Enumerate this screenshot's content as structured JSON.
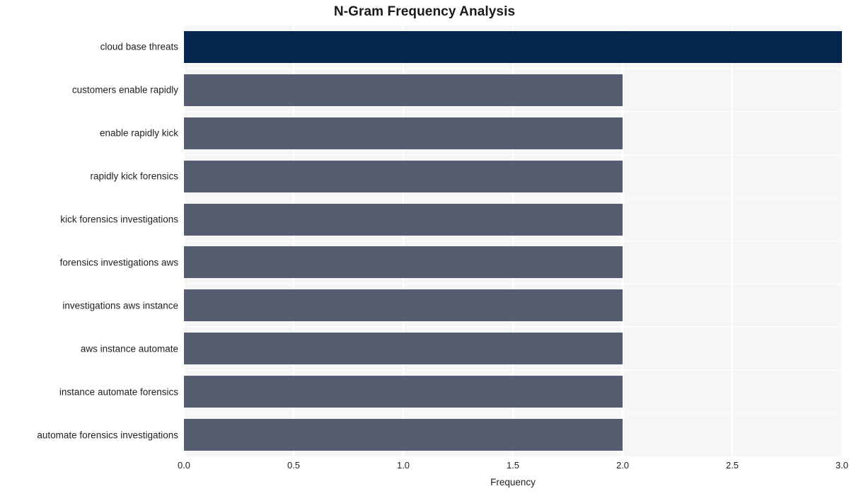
{
  "chart_data": {
    "type": "bar",
    "orientation": "horizontal",
    "title": "N-Gram Frequency Analysis",
    "xlabel": "Frequency",
    "ylabel": "",
    "xlim": [
      0,
      3.0
    ],
    "xticks": [
      "0.0",
      "0.5",
      "1.0",
      "1.5",
      "2.0",
      "2.5",
      "3.0"
    ],
    "xtick_values": [
      0,
      0.5,
      1.0,
      1.5,
      2.0,
      2.5,
      3.0
    ],
    "grid": true,
    "legend": "none",
    "categories": [
      "cloud base threats",
      "customers enable rapidly",
      "enable rapidly kick",
      "rapidly kick forensics",
      "kick forensics investigations",
      "forensics investigations aws",
      "investigations aws instance",
      "aws instance automate",
      "instance automate forensics",
      "automate forensics investigations"
    ],
    "values": [
      3,
      2,
      2,
      2,
      2,
      2,
      2,
      2,
      2,
      2
    ],
    "bar_colors": [
      "#06254f",
      "#565d70",
      "#565d70",
      "#565d70",
      "#565d70",
      "#565d70",
      "#565d70",
      "#565d70",
      "#565d70",
      "#565d70"
    ]
  },
  "style": {
    "figure_background": "#ffffff",
    "plot_background": "#f6f6f7",
    "gridline_color": "#ffffff",
    "title_color": "#1a1a1a",
    "tick_label_color": "#1f1f1f",
    "highlight_color": "#06254f",
    "base_bar_color": "#565d70"
  }
}
